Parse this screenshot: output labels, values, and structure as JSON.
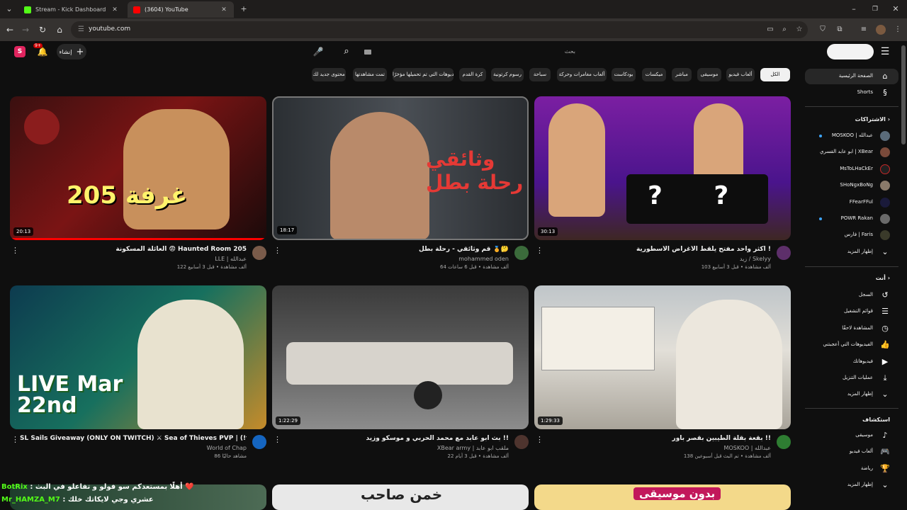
{
  "browser": {
    "tabs": [
      {
        "title": "Stream - Kick Dashboard",
        "color": "#53fc18"
      },
      {
        "title": "(3604) YouTube",
        "color": "#ff0000"
      }
    ],
    "url": "youtube.com"
  },
  "header": {
    "create_label": "إنشاء",
    "notifications_count": "9+",
    "search_placeholder": "بحث"
  },
  "chips": [
    {
      "label": "محتوى جديد لك"
    },
    {
      "label": "تمت مشاهدتها"
    },
    {
      "label": "الفيديوهات التي تم تحميلها مؤخرًا"
    },
    {
      "label": "كرة القدم"
    },
    {
      "label": "رسوم كرتونية"
    },
    {
      "label": "سباحة"
    },
    {
      "label": "ألعاب مغامرات وحركة"
    },
    {
      "label": "بودكاست"
    },
    {
      "label": "ميكسات"
    },
    {
      "label": "مباشر"
    },
    {
      "label": "موسيقى"
    },
    {
      "label": "ألعاب فيديو"
    },
    {
      "label": "الكل"
    }
  ],
  "videos": [
    {
      "title": "العائلة المسكونة 😨 Haunted Room 205",
      "channel": "LLE | عبدالله",
      "stats": "122 ألف مشاهدة • قبل 3 أسابيع",
      "duration": "20:13",
      "thumb_text": "غرفة 205",
      "accent": "#c0392b"
    },
    {
      "title": "قم وثائقي - رحلة بطل 🏅🤔",
      "channel": "mohammed oden",
      "stats": "64 ألف مشاهدة • قبل 6 ساعات",
      "duration": "18:17",
      "thumb_text": "وثائقي رحلة بطل",
      "accent": "#e53935"
    },
    {
      "title": "اكثر واحد مفتح يلقط الأغراض الأسطورية !",
      "channel": "زيد / Skelyy",
      "stats": "103 ألف مشاهدة • قبل 3 أسابيع",
      "duration": "30:13",
      "thumb_text": "? ?",
      "accent": "#8e24aa"
    },
    {
      "title": "SL Sails Giveaway (ONLY ON TWITCH) ⚔ Sea of Thieves PVP | (!figgyz) (!discord) (!youtube)",
      "channel": "World of Chap",
      "stats": "86 مشاهد حاليًا",
      "duration": "",
      "thumb_text": "LIVE Mar 22nd",
      "accent": "#f9a825"
    },
    {
      "title": "بث ابو عابد مع محمد الحربي و موسكو وزيد !!",
      "channel": "XBear army | ملقب ابو عابد",
      "stats": "22 ألف مشاهدة • قبل 3 أيام",
      "duration": "1:22:29",
      "thumb_text": "",
      "accent": "#616161"
    },
    {
      "title": "بقعة بقلة الطيبين بقصر باور !!",
      "channel": "MOSKOO | عبدالله",
      "stats": "138 ألف مشاهدة • تم البث قبل أسبوعين",
      "duration": "1:29:33",
      "thumb_text": "",
      "accent": "#9e9e9e"
    },
    {
      "title": "",
      "channel": "",
      "stats": "",
      "duration": "",
      "thumb_text": "",
      "accent": "#333"
    },
    {
      "title": "",
      "channel": "",
      "stats": "",
      "duration": "",
      "thumb_text": "خمن صاحب",
      "accent": "#e0e0e0"
    },
    {
      "title": "",
      "channel": "",
      "stats": "",
      "duration": "",
      "thumb_text": "بدون موسيقى",
      "accent": "#f0d080"
    }
  ],
  "sidebar": {
    "home": "الصفحة الرئيسية",
    "shorts": "Shorts",
    "subscriptions_head": "الاشتراكات",
    "subscriptions": [
      {
        "label": "MOSKOO | عبدالله",
        "dot": true
      },
      {
        "label": "ابو عابد القسري | XBear",
        "dot": false
      },
      {
        "label": "MsToLHaCkEr",
        "dot": false
      },
      {
        "label": "SHoNgxBoNg",
        "dot": false
      },
      {
        "label": "FFearFFul",
        "dot": false
      },
      {
        "label": "POWR Rakan",
        "dot": true
      },
      {
        "label": "فارس | Faris",
        "dot": false
      }
    ],
    "show_more_1": "إظهار المزيد",
    "you_head": "أنت",
    "you_items": [
      {
        "label": "السجل",
        "icon": "history-icon"
      },
      {
        "label": "قوائم التشغيل",
        "icon": "playlist-icon"
      },
      {
        "label": "المشاهدة لاحقًا",
        "icon": "clock-icon"
      },
      {
        "label": "الفيديوهات التي أعجبتني",
        "icon": "like-icon"
      },
      {
        "label": "فيديوهاتك",
        "icon": "video-icon"
      },
      {
        "label": "عمليات التنزيل",
        "icon": "download-icon"
      }
    ],
    "show_more_2": "إظهار المزيد",
    "explore_head": "استكشاف",
    "explore_items": [
      {
        "label": "موسيقى",
        "icon": "music-icon"
      },
      {
        "label": "ألعاب فيديو",
        "icon": "gamepad-icon"
      },
      {
        "label": "رياضة",
        "icon": "trophy-icon"
      }
    ],
    "show_more_3": "إظهار المزيد"
  },
  "chat": [
    {
      "user": "BotRix",
      "user_color": "#53fc18",
      "text": ": أهلًا بمستعدكم سو فولو و تفاعلو في البث ❤️"
    },
    {
      "user": "Mr_HAMZA_M7",
      "user_color": "#53fc18",
      "text": ": عشري وجي لايكاتك خلك"
    }
  ]
}
